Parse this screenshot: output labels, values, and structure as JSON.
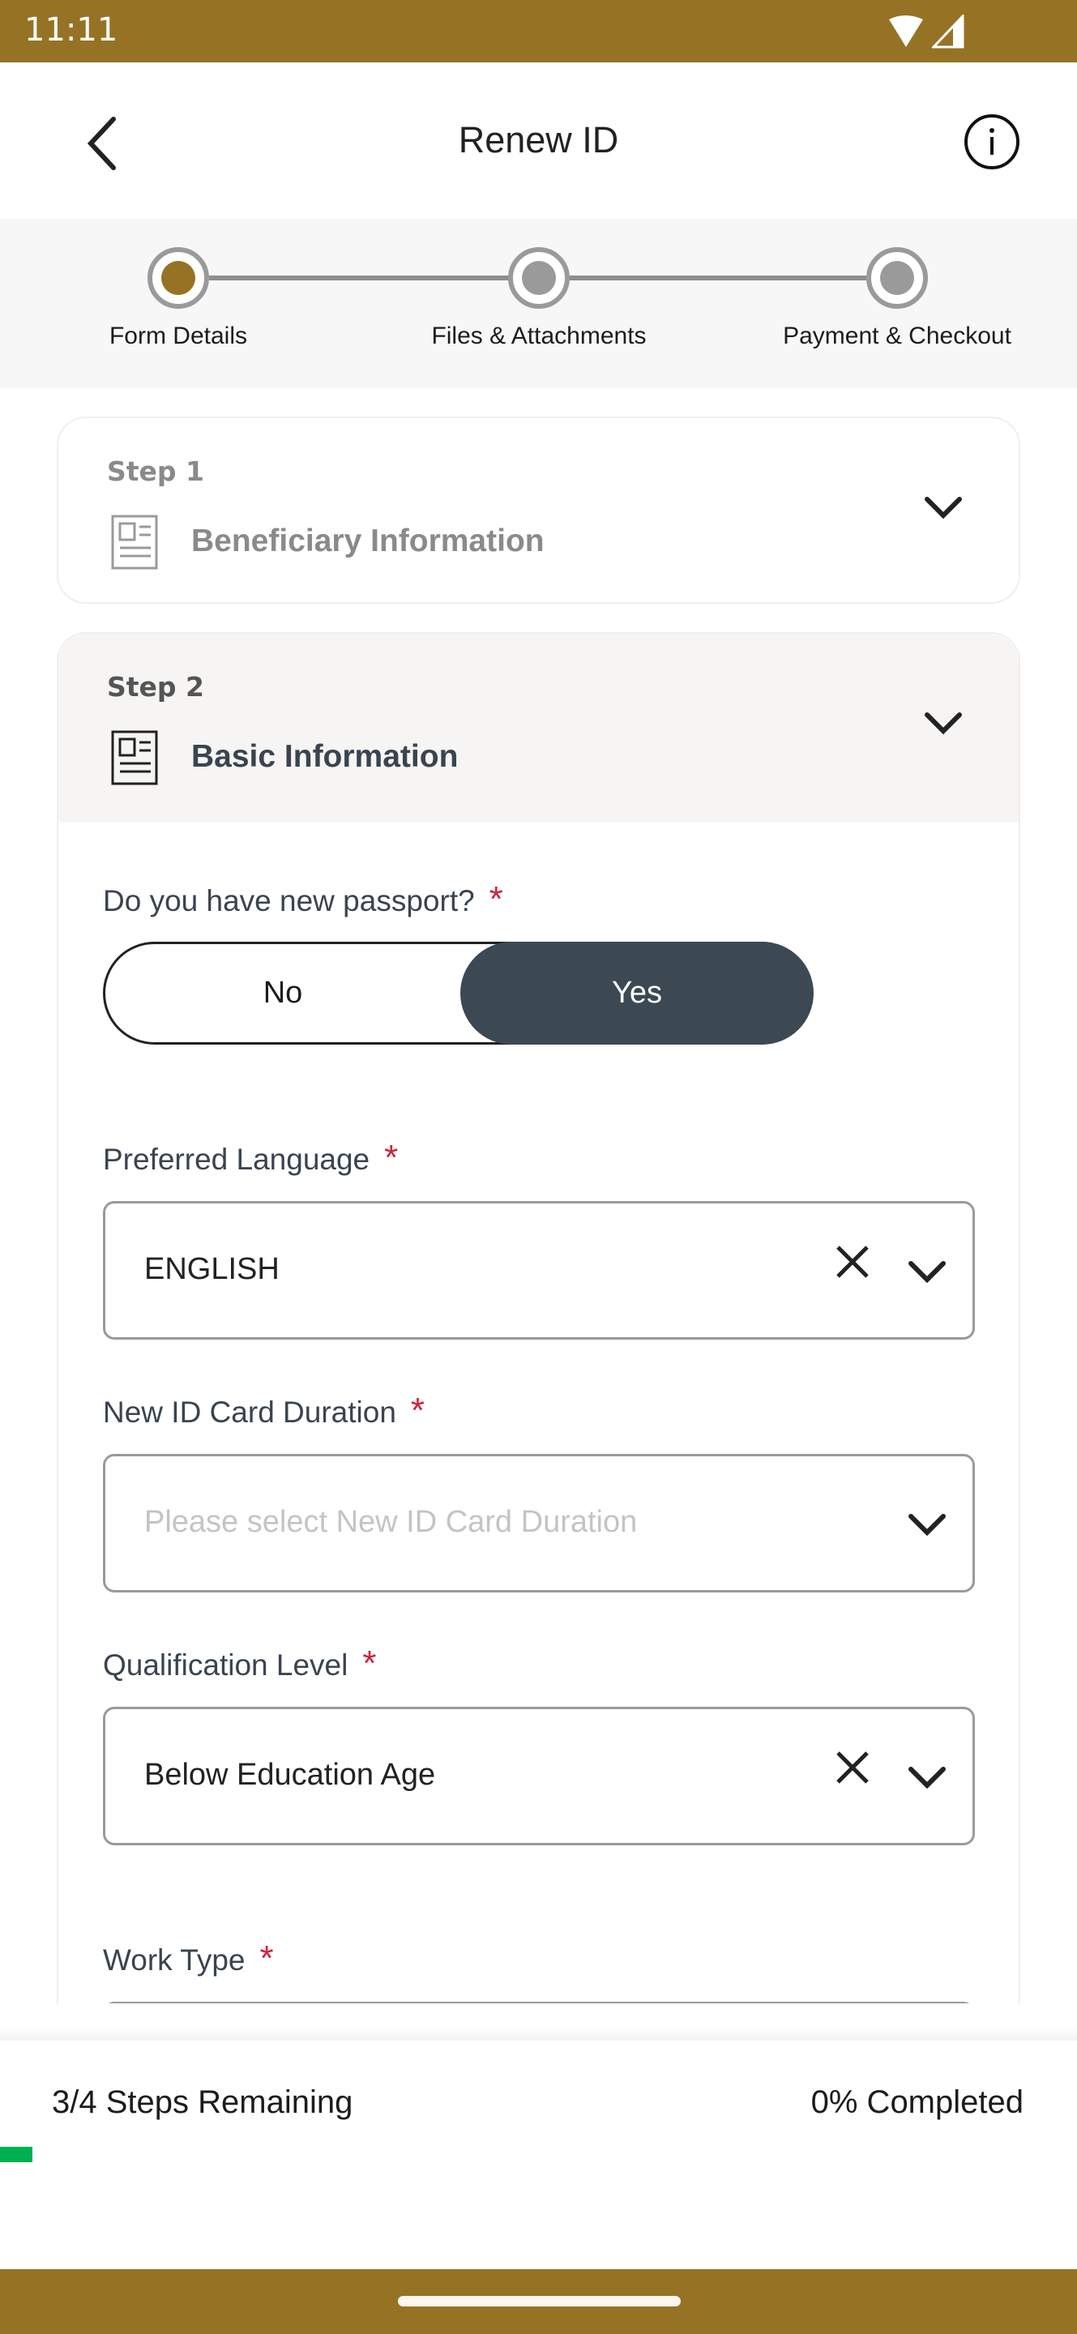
{
  "status_bar": {
    "time": "11:11",
    "icons": [
      "wifi-icon",
      "signal-icon"
    ]
  },
  "header": {
    "title": "Renew ID",
    "back_icon": "chevron-left-icon",
    "info_icon": "info-icon"
  },
  "stepper": {
    "steps": [
      {
        "label": "Form Details",
        "active": true
      },
      {
        "label": "Files & Attachments",
        "active": false
      },
      {
        "label": "Payment & Checkout",
        "active": false
      }
    ],
    "active_color": "#967224"
  },
  "sections": [
    {
      "step": "Step 1",
      "title": "Beneficiary Information"
    },
    {
      "step": "Step 2",
      "title": "Basic Information"
    }
  ],
  "form": {
    "passport": {
      "label": "Do you have new passport?",
      "required": "*",
      "options": [
        "No",
        "Yes"
      ],
      "selected": "Yes"
    },
    "language": {
      "label": "Preferred Language",
      "required": "*",
      "value": "ENGLISH"
    },
    "duration": {
      "label": "New ID Card Duration",
      "required": "*",
      "placeholder": "Please select New ID Card Duration"
    },
    "qualification": {
      "label": "Qualification Level",
      "required": "*",
      "value": "Below Education Age"
    },
    "work_type": {
      "label": "Work Type",
      "required": "*"
    }
  },
  "footer": {
    "steps_remaining": "3/4 Steps Remaining",
    "completed": "0% Completed",
    "progress_percent": 0,
    "progress_color": "#00b050"
  }
}
